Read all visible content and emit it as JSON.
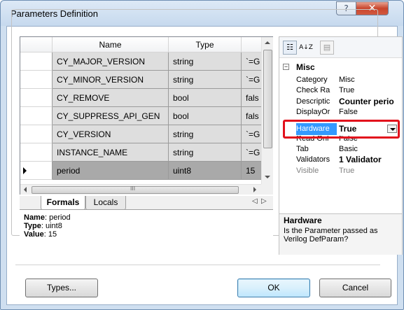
{
  "window": {
    "title": "Parameters Definition",
    "help_glyph": "?",
    "close_glyph": "✕"
  },
  "grid": {
    "columns": [
      "Name",
      "Type",
      ""
    ],
    "rows": [
      {
        "name": "CY_MAJOR_VERSION",
        "type": "string",
        "value": "`=G"
      },
      {
        "name": "CY_MINOR_VERSION",
        "type": "string",
        "value": "`=G"
      },
      {
        "name": "CY_REMOVE",
        "type": "bool",
        "value": "fals"
      },
      {
        "name": "CY_SUPPRESS_API_GEN",
        "type": "bool",
        "value": "fals"
      },
      {
        "name": "CY_VERSION",
        "type": "string",
        "value": "`=G"
      },
      {
        "name": "INSTANCE_NAME",
        "type": "string",
        "value": "`=G"
      },
      {
        "name": "period",
        "type": "uint8",
        "value": "15"
      }
    ],
    "hscroll_grip": "III"
  },
  "tabs": {
    "formals": "Formals",
    "locals": "Locals",
    "nav_prev": "◁",
    "nav_next": "▷"
  },
  "info": {
    "name_label": "Name",
    "name_value": ": period",
    "type_label": "Type",
    "type_value": ": uint8",
    "value_label": "Value",
    "value_value": ": 15"
  },
  "props": {
    "toolbar": {
      "categorized": "☷",
      "alpha": "A↓Z",
      "pages": "▤"
    },
    "section": "Misc",
    "section_toggle": "−",
    "rows": [
      {
        "key": "Category",
        "value": "Misc"
      },
      {
        "key": "Check Ra",
        "value": "True"
      },
      {
        "key": "Descriptic",
        "value": "Counter perio"
      },
      {
        "key": "DisplayOr",
        "value": "False"
      },
      {
        "key": "Hardware",
        "value": "True"
      },
      {
        "key": "Read Onl",
        "value": "False"
      },
      {
        "key": "Tab",
        "value": "Basic"
      },
      {
        "key": "Validators",
        "value": "1 Validator"
      },
      {
        "key": "Visible",
        "value": "True"
      }
    ],
    "desc_title": "Hardware",
    "desc_text": "Is the Parameter passed as Verilog DefParam?"
  },
  "buttons": {
    "types": "Types...",
    "ok": "OK",
    "cancel": "Cancel"
  },
  "colors": {
    "highlight": "#3399ff",
    "callout": "#e2101c",
    "row_bg": "#dedede",
    "row_selected": "#a9a9a9"
  }
}
